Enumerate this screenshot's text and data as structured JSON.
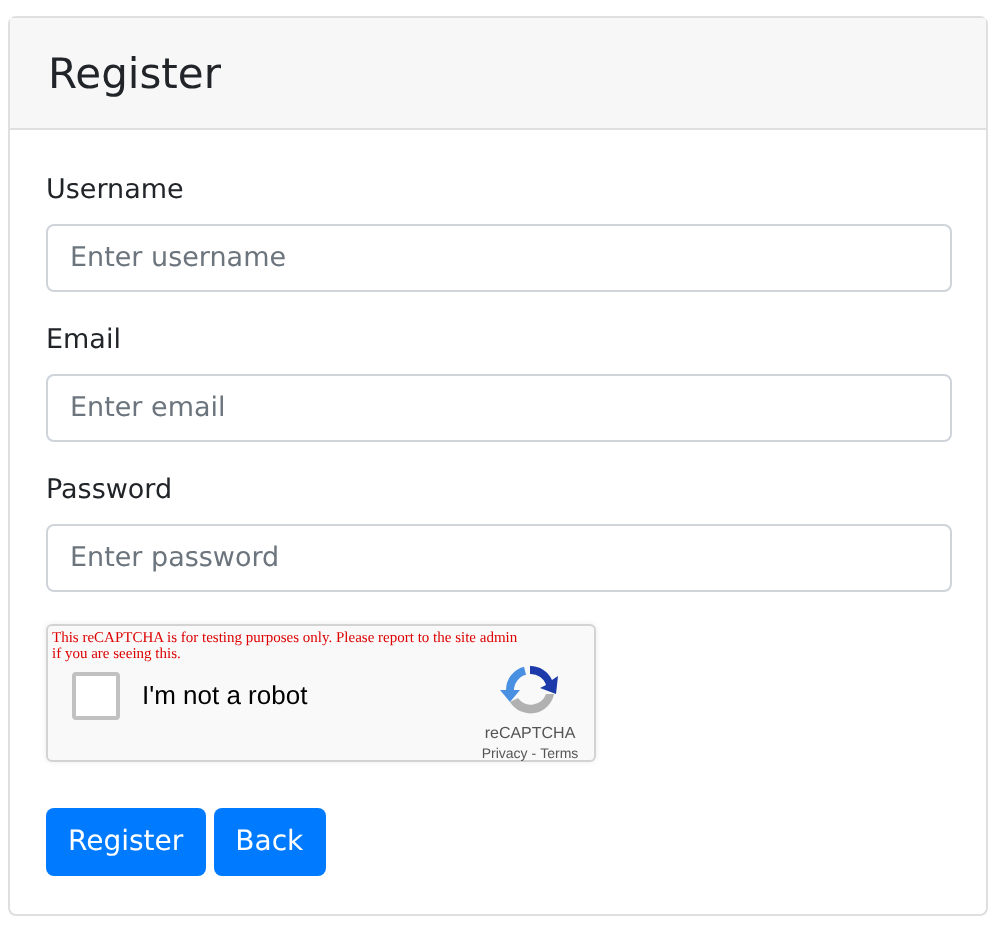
{
  "card": {
    "title": "Register"
  },
  "fields": [
    {
      "label": "Username",
      "placeholder": "Enter username"
    },
    {
      "label": "Email",
      "placeholder": "Enter email"
    },
    {
      "label": "Password",
      "placeholder": "Enter password"
    }
  ],
  "captcha": {
    "warning": "This reCAPTCHA is for testing purposes only. Please report to the site admin if you are seeing this.",
    "label": "I'm not a robot",
    "checked": false,
    "brand": "reCAPTCHA",
    "links": [
      "Privacy",
      "Terms"
    ],
    "separator": "-"
  },
  "buttons": [
    "Register",
    "Back"
  ]
}
